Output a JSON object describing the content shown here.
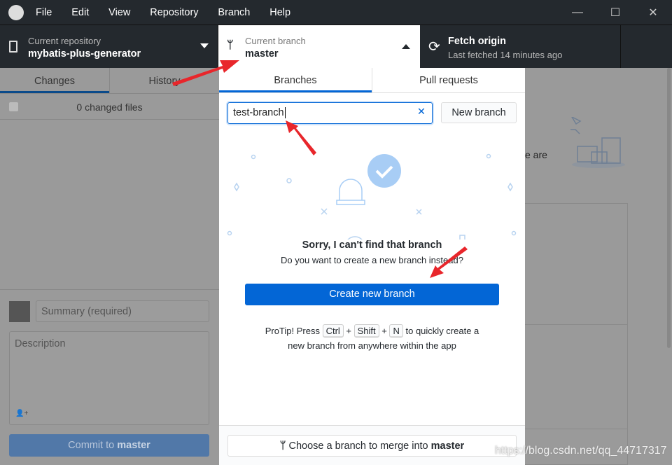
{
  "menu": [
    "File",
    "Edit",
    "View",
    "Repository",
    "Branch",
    "Help"
  ],
  "toolbar": {
    "repo_label": "Current repository",
    "repo_name": "mybatis-plus-generator",
    "branch_label": "Current branch",
    "branch_name": "master",
    "fetch_title": "Fetch origin",
    "fetch_sub": "Last fetched 14 minutes ago"
  },
  "left": {
    "tabs": [
      "Changes",
      "History"
    ],
    "changed_files": "0 changed files",
    "summary_placeholder": "Summary (required)",
    "description_placeholder": "Description",
    "commit_prefix": "Commit to ",
    "commit_branch": "master"
  },
  "right": {
    "partial_text": "e are"
  },
  "popup": {
    "tabs": [
      "Branches",
      "Pull requests"
    ],
    "filter_value": "test-branch",
    "new_branch": "New branch",
    "sorry": "Sorry, I can't find that branch",
    "ask": "Do you want to create a new branch instead?",
    "create": "Create new branch",
    "tip_pre": "ProTip! Press",
    "key_ctrl": "Ctrl",
    "key_shift": "Shift",
    "key_n": "N",
    "tip_post": "to quickly create a",
    "tip_line2": "new branch from anywhere within the app",
    "merge_prefix": "Choose a branch to merge into ",
    "merge_branch": "master"
  },
  "watermark": "https://blog.csdn.net/qq_44717317",
  "colors": {
    "accent": "#0366d6",
    "titlebar": "#24292e",
    "annotation_arrow": "#e8262b"
  }
}
